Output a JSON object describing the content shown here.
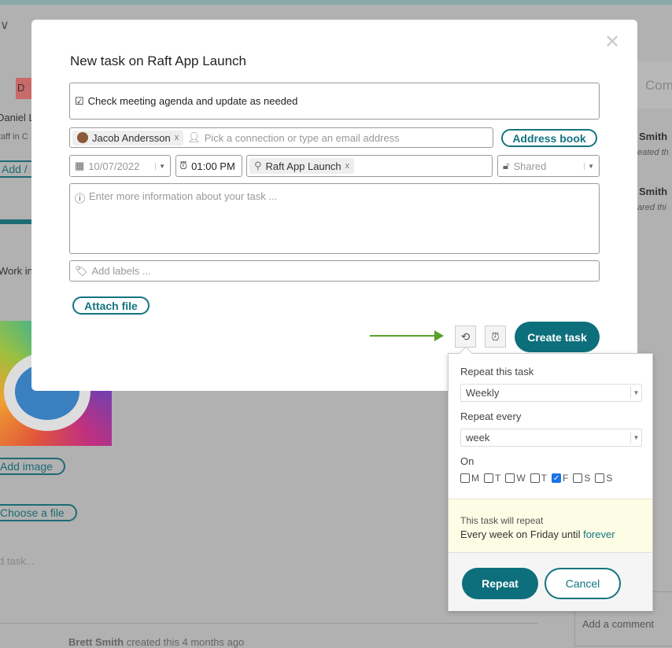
{
  "background": {
    "left_items": [
      "D",
      "Daniel L",
      "taff in C",
      "Add / I",
      "Work in",
      "Add image",
      "Choose a file",
      "d task..."
    ],
    "right_items": [
      "Com",
      "Smith",
      "eated th",
      "Smith",
      "ared thi"
    ],
    "add_comment": "Add a comment",
    "activity": {
      "user": "Brett Smith",
      "text": "created this 4 months ago"
    }
  },
  "modal": {
    "title": "New task on Raft App Launch",
    "task_text": "Check meeting agenda and update as needed",
    "assignee": "Jacob Andersson",
    "assignee_placeholder": "Pick a connection or type an email address",
    "address_book": "Address book",
    "date": "10/07/2022",
    "time": "01:00 PM",
    "project": "Raft App Launch",
    "visibility": "Shared",
    "description_placeholder": "Enter more information about your task ...",
    "labels_placeholder": "Add labels ...",
    "attach_file": "Attach file",
    "create_task": "Create task",
    "remove": "x"
  },
  "repeat_popover": {
    "repeat_label": "Repeat this task",
    "repeat_value": "Weekly",
    "every_label": "Repeat every",
    "every_value": "week",
    "on_label": "On",
    "days": [
      {
        "l": "M",
        "c": false
      },
      {
        "l": "T",
        "c": false
      },
      {
        "l": "W",
        "c": false
      },
      {
        "l": "T",
        "c": false
      },
      {
        "l": "F",
        "c": true
      },
      {
        "l": "S",
        "c": false
      },
      {
        "l": "S",
        "c": false
      }
    ],
    "summary_intro": "This task will repeat",
    "summary": "Every week on Friday until",
    "summary_link": "forever",
    "repeat_button": "Repeat",
    "cancel_button": "Cancel"
  },
  "colors": {
    "accent": "#0e6f7c",
    "arrow": "#5aa02c",
    "summary_bg": "#fdfde6"
  }
}
